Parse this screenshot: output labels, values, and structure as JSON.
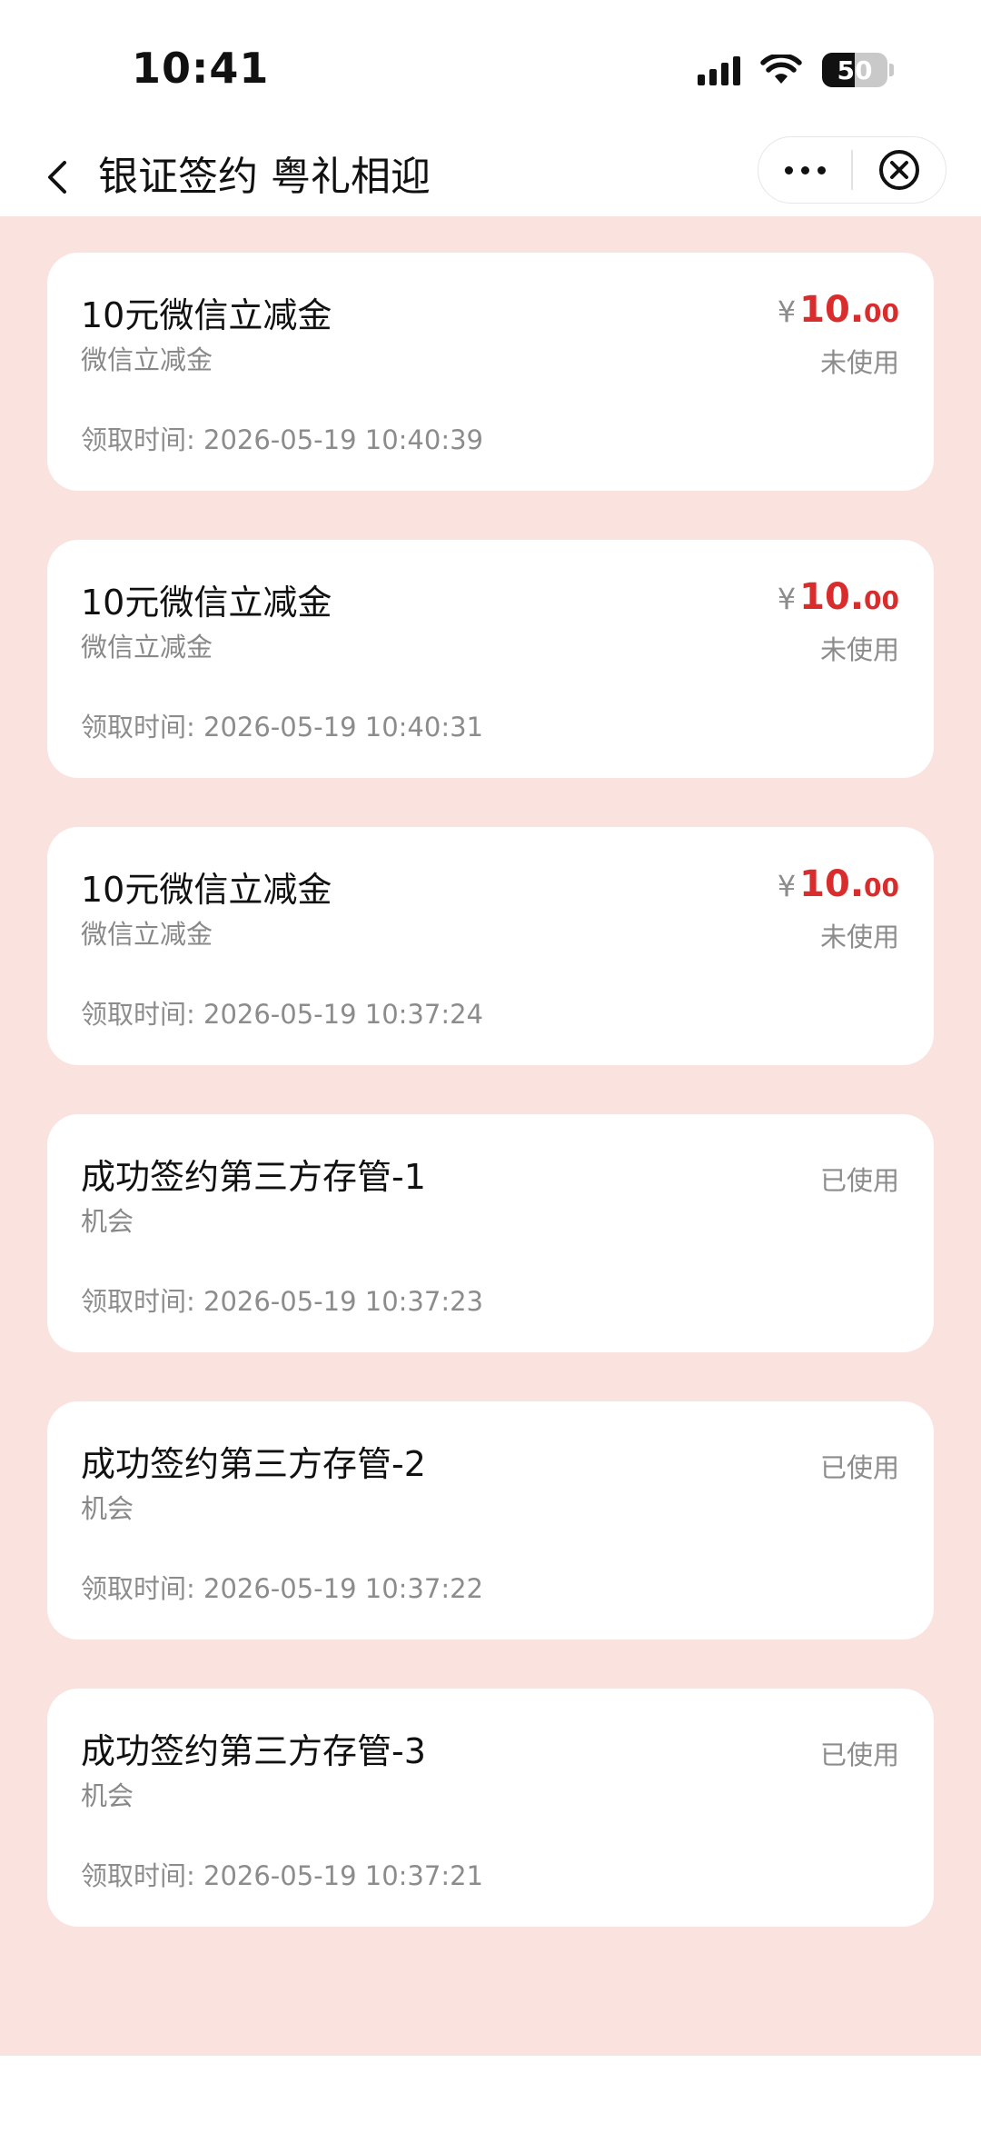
{
  "status_bar": {
    "time": "10:41",
    "battery": "50",
    "battery_level": 0.5
  },
  "nav": {
    "title": "银证签约 粤礼相迎"
  },
  "currency_symbol": "¥",
  "records": [
    {
      "title": "10元微信立减金",
      "subtitle": "微信立减金",
      "time": "领取时间: 2026-05-19 10:40:39",
      "price_int": "10.",
      "price_dec": "00",
      "status": "未使用"
    },
    {
      "title": "10元微信立减金",
      "subtitle": "微信立减金",
      "time": "领取时间: 2026-05-19 10:40:31",
      "price_int": "10.",
      "price_dec": "00",
      "status": "未使用"
    },
    {
      "title": "10元微信立减金",
      "subtitle": "微信立减金",
      "time": "领取时间: 2026-05-19 10:37:24",
      "price_int": "10.",
      "price_dec": "00",
      "status": "未使用"
    },
    {
      "title": "成功签约第三方存管-1",
      "subtitle": "机会",
      "time": "领取时间: 2026-05-19 10:37:23",
      "status": "已使用"
    },
    {
      "title": "成功签约第三方存管-2",
      "subtitle": "机会",
      "time": "领取时间: 2026-05-19 10:37:22",
      "status": "已使用"
    },
    {
      "title": "成功签约第三方存管-3",
      "subtitle": "机会",
      "time": "领取时间: 2026-05-19 10:37:21",
      "status": "已使用"
    }
  ],
  "colors": {
    "accent_red": "#d92d2d",
    "background_pink": "#fae2de"
  }
}
